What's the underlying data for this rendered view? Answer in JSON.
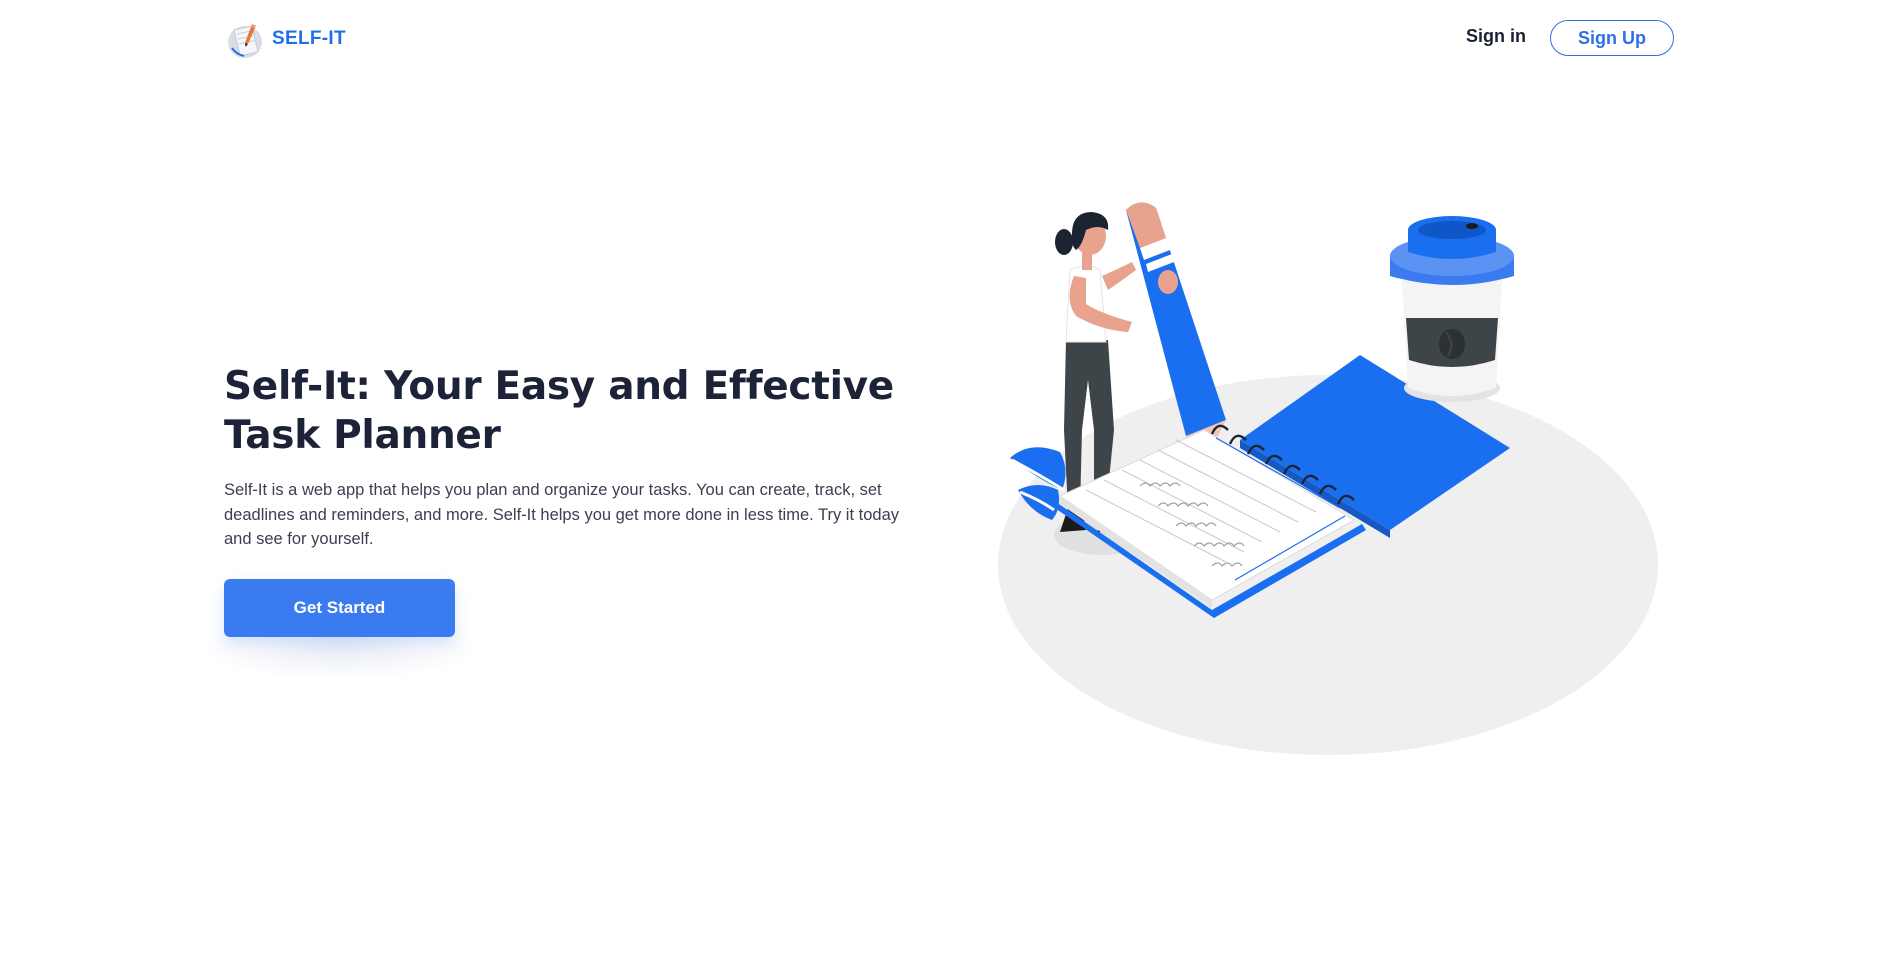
{
  "brand": {
    "name": "SELF-IT",
    "logo_icon": "notebook-pencil-logo",
    "accent_color": "#1f6feb"
  },
  "nav": {
    "signin_label": "Sign in",
    "signup_label": "Sign Up"
  },
  "hero": {
    "title": "Self-It: Your Easy and Effective Task Planner",
    "description": "Self-It is a web app that helps you plan and organize your tasks. You can create, track, set deadlines and reminders, and more. Self-It helps you get more done in less time. Try it today and see for yourself.",
    "cta_label": "Get Started",
    "cta_color": "#3a7bf0"
  },
  "illustration": {
    "icon": "woman-writing-notebook-illustration",
    "primary_color": "#1a6ef0"
  }
}
